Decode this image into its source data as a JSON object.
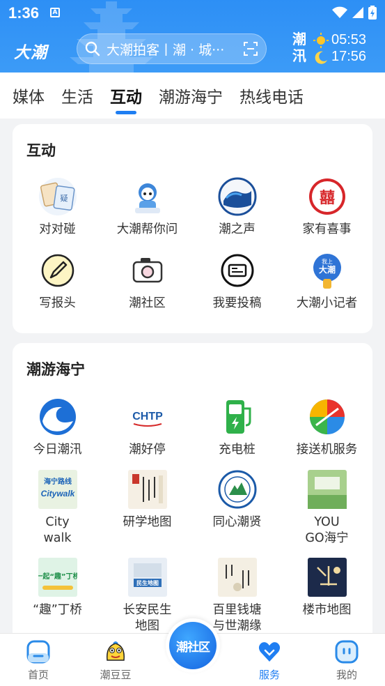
{
  "status": {
    "time": "1:36",
    "notif": "A"
  },
  "header": {
    "brand": "大潮",
    "search_placeholder": "大潮拍客丨潮 · 城···",
    "tide_label": "潮汛",
    "sunrise": "05:53",
    "sunset": "17:56"
  },
  "tabs": [
    "媒体",
    "生活",
    "互动",
    "潮游海宁",
    "热线电话"
  ],
  "interaction": {
    "title": "互动",
    "items": [
      {
        "label": "对对碰",
        "icon": "dui-dui-peng-icon"
      },
      {
        "label": "大潮帮你问",
        "icon": "mascot-ask-icon"
      },
      {
        "label": "潮之声",
        "icon": "wave-voice-icon"
      },
      {
        "label": "家有喜事",
        "icon": "double-happiness-icon"
      },
      {
        "label": "写报头",
        "icon": "pencil-icon"
      },
      {
        "label": "潮社区",
        "icon": "camera-icon"
      },
      {
        "label": "我要投稿",
        "icon": "submit-article-icon"
      },
      {
        "label": "大潮小记者",
        "icon": "mini-reporter-icon"
      }
    ],
    "badge_text": "大潮",
    "badge_small": "我上"
  },
  "tour": {
    "title": "潮游海宁",
    "items": [
      {
        "label": "今日潮汛",
        "icon": "wave-icon"
      },
      {
        "label": "潮好停",
        "icon": "parking-icon",
        "img_text": "CHTP"
      },
      {
        "label": "充电桩",
        "icon": "charging-station-icon"
      },
      {
        "label": "接送机服务",
        "icon": "airport-shuttle-icon"
      },
      {
        "label": "City walk",
        "line1": "City",
        "line2": "walk",
        "icon": "citywalk-icon",
        "img_text": "海宁路线",
        "img_text2": "Citywalk"
      },
      {
        "label": "研学地图",
        "icon": "study-map-icon"
      },
      {
        "label": "同心潮贤",
        "icon": "tongxin-seal-icon"
      },
      {
        "label": "YOU GO海宁",
        "line1": "YOU",
        "line2": "GO海宁",
        "icon": "yougo-icon"
      },
      {
        "label": "“趣”丁桥",
        "icon": "dingqiao-icon",
        "img_text": "一起“趣”丁桥"
      },
      {
        "label": "长安民生地图",
        "line1": "长安民生",
        "line2": "地图",
        "icon": "changan-map-icon",
        "img_text": "民生地图"
      },
      {
        "label": "百里钱塘与世潮缘",
        "line1": "百里钱塘",
        "line2": "与世潮缘",
        "icon": "qiantang-icon"
      },
      {
        "label": "楼市地图",
        "icon": "property-map-icon"
      }
    ]
  },
  "bottom_nav": {
    "home": "首页",
    "chaodoudou": "潮豆豆",
    "center": "潮社区",
    "service": "服务",
    "mine": "我的"
  },
  "colors": {
    "accent": "#1f7ef2",
    "header": "#2d8ff5"
  }
}
